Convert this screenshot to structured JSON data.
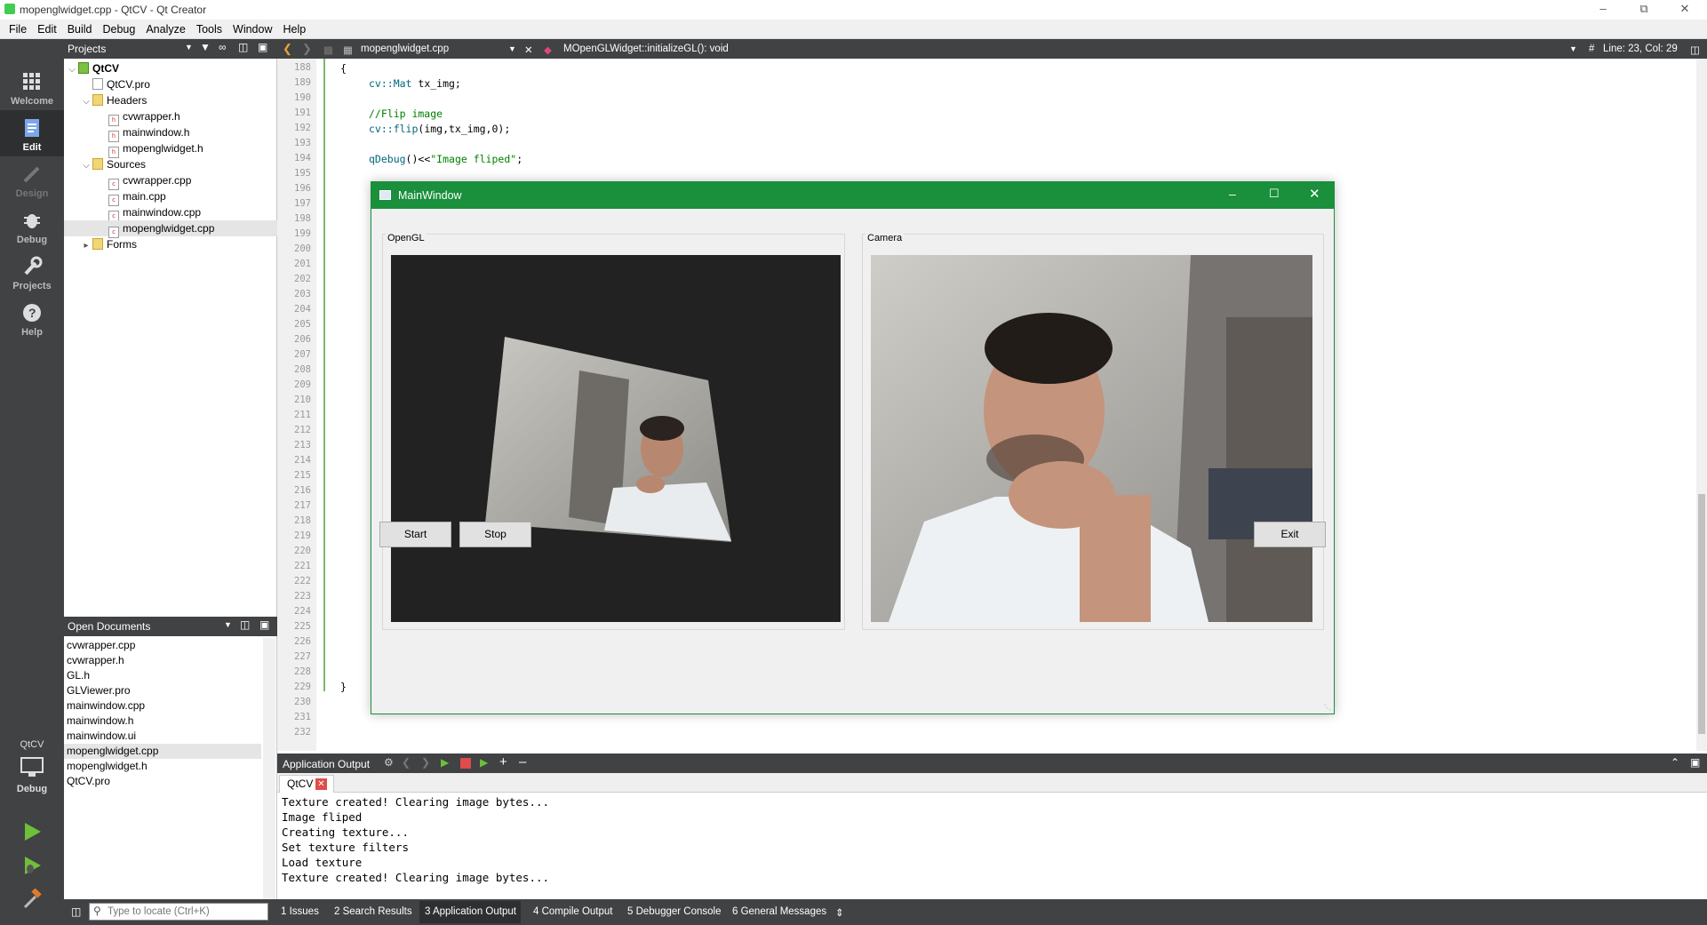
{
  "window": {
    "title": "mopenglwidget.cpp - QtCV - Qt Creator"
  },
  "menu": [
    "File",
    "Edit",
    "Build",
    "Debug",
    "Analyze",
    "Tools",
    "Window",
    "Help"
  ],
  "modes": {
    "welcome": "Welcome",
    "edit": "Edit",
    "design": "Design",
    "debug": "Debug",
    "projects": "Projects",
    "help": "Help",
    "kit_name": "QtCV",
    "kit_mode": "Debug"
  },
  "projects_pane": {
    "title": "Projects",
    "tree": {
      "root": "QtCV",
      "pro": "QtCV.pro",
      "headers": "Headers",
      "header_files": [
        "cvwrapper.h",
        "mainwindow.h",
        "mopenglwidget.h"
      ],
      "sources": "Sources",
      "source_files": [
        "cvwrapper.cpp",
        "main.cpp",
        "mainwindow.cpp",
        "mopenglwidget.cpp"
      ],
      "forms": "Forms"
    }
  },
  "open_documents": {
    "title": "Open Documents",
    "files": [
      "cvwrapper.cpp",
      "cvwrapper.h",
      "GL.h",
      "GLViewer.pro",
      "mainwindow.cpp",
      "mainwindow.h",
      "mainwindow.ui",
      "mopenglwidget.cpp",
      "mopenglwidget.h",
      "QtCV.pro"
    ]
  },
  "editor": {
    "file": "mopenglwidget.cpp",
    "symbol": "MOpenGLWidget::initializeGL(): void",
    "position": "Line: 23, Col: 29",
    "line_numbers": [
      "188",
      "189",
      "190",
      "191",
      "192",
      "193",
      "194",
      "195",
      "196",
      "197",
      "198",
      "199",
      "200",
      "201",
      "202",
      "203",
      "204",
      "205",
      "206",
      "207",
      "208",
      "209",
      "210",
      "211",
      "212",
      "213",
      "214",
      "215",
      "216",
      "217",
      "218",
      "219",
      "220",
      "221",
      "222",
      "223",
      "224",
      "225",
      "226",
      "227",
      "228",
      "229",
      "230",
      "231",
      "232"
    ],
    "code": {
      "l188": "{",
      "l189_type": "cv::Mat",
      "l189_rest": " tx_img;",
      "l191": "//Flip image",
      "l192_fn": "cv::flip",
      "l192_rest": "(img,tx_img,0);",
      "l194_fn": "qDebug",
      "l194_mid": "()<<",
      "l194_str": "\"Image fliped\"",
      "l194_end": ";",
      "l229": "}"
    }
  },
  "output": {
    "title": "Application Output",
    "tab": "QtCV",
    "lines": [
      "Texture created! Clearing image bytes...",
      "Image fliped",
      "Creating texture...",
      "Set texture filters",
      "Load texture",
      "Texture created! Clearing image bytes..."
    ]
  },
  "statusbar": {
    "locator_placeholder": "Type to locate (Ctrl+K)",
    "tabs": [
      "1  Issues",
      "2  Search Results",
      "3  Application Output",
      "4  Compile Output",
      "5  Debugger Console",
      "6  General Messages"
    ]
  },
  "main_window": {
    "title": "MainWindow",
    "opengl_label": "OpenGL",
    "camera_label": "Camera",
    "start": "Start",
    "stop": "Stop",
    "exit": "Exit"
  },
  "colors": {
    "accent_green": "#1a8f3c",
    "dark_panel": "#404244",
    "code_keyword": "#00677c",
    "code_comment": "#008000",
    "code_string": "#008000"
  }
}
